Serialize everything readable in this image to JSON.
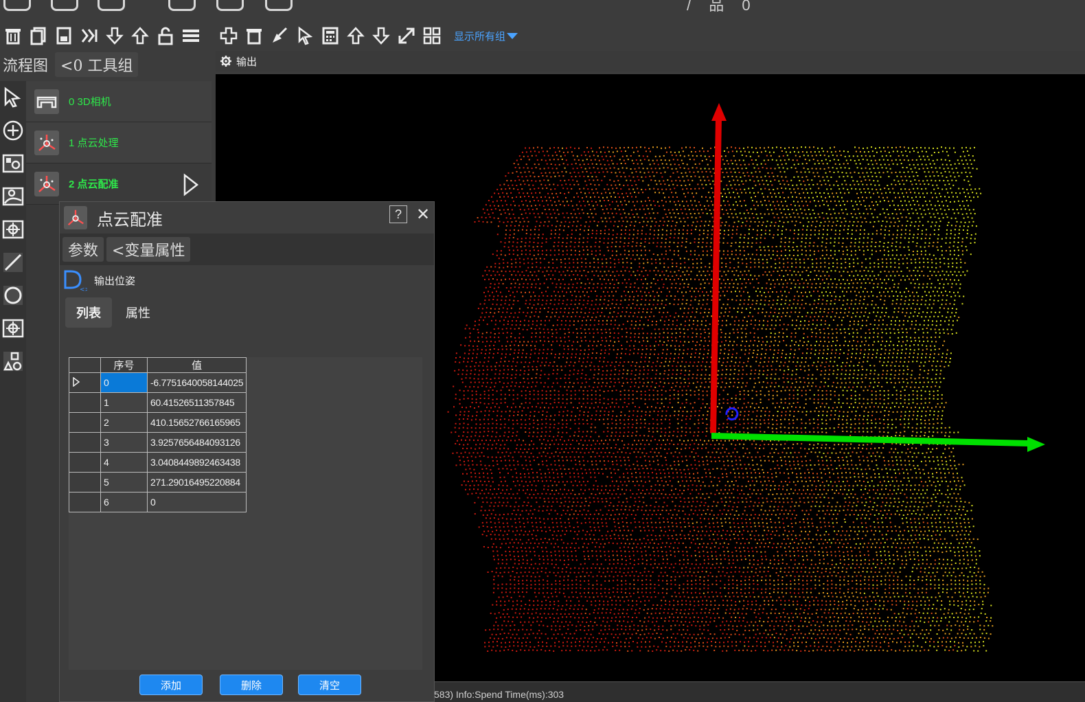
{
  "top_strip": {
    "partial_text": "/ 品 0"
  },
  "toolbar": {
    "show_all_groups_label": "显示所有组"
  },
  "breadcrumb": {
    "flow_label": "流程图",
    "group_label": "<0 工具组"
  },
  "output_panel": {
    "title": "输出"
  },
  "flow_items": [
    {
      "label": "0  3D相机",
      "icon": "camera-3d-icon"
    },
    {
      "label": "1  点云处理",
      "icon": "pointcloud-tool-icon"
    },
    {
      "label": "2  点云配准",
      "icon": "pointcloud-tool-icon"
    }
  ],
  "dialog": {
    "title": "点云配准",
    "help_label": "?",
    "close_label": "✕",
    "tabs": [
      "参数",
      "<变量属性"
    ],
    "variable_name": "输出位姿",
    "sub_tabs": [
      "列表",
      "属性"
    ],
    "table": {
      "headers": [
        "序号",
        "值"
      ],
      "rows": [
        {
          "index": "0",
          "value": "-6.7751640058144025",
          "selected": true
        },
        {
          "index": "1",
          "value": "60.41526511357845"
        },
        {
          "index": "2",
          "value": "410.15652766165965"
        },
        {
          "index": "3",
          "value": "3.9257656484093126"
        },
        {
          "index": "4",
          "value": "3.0408449892463438"
        },
        {
          "index": "5",
          "value": "271.29016495220884"
        },
        {
          "index": "6",
          "value": "0"
        }
      ]
    },
    "buttons": {
      "add": "添加",
      "delete": "删除",
      "clear": "清空"
    }
  },
  "status_bar": {
    "text": "583)  Info:Spend Time(ms):303"
  },
  "colors": {
    "flow_label": "#2ee84a",
    "accent_blue": "#1e88f0",
    "axis_x": "#00e000",
    "axis_y": "#e00000",
    "axis_z": "#0000ff"
  }
}
